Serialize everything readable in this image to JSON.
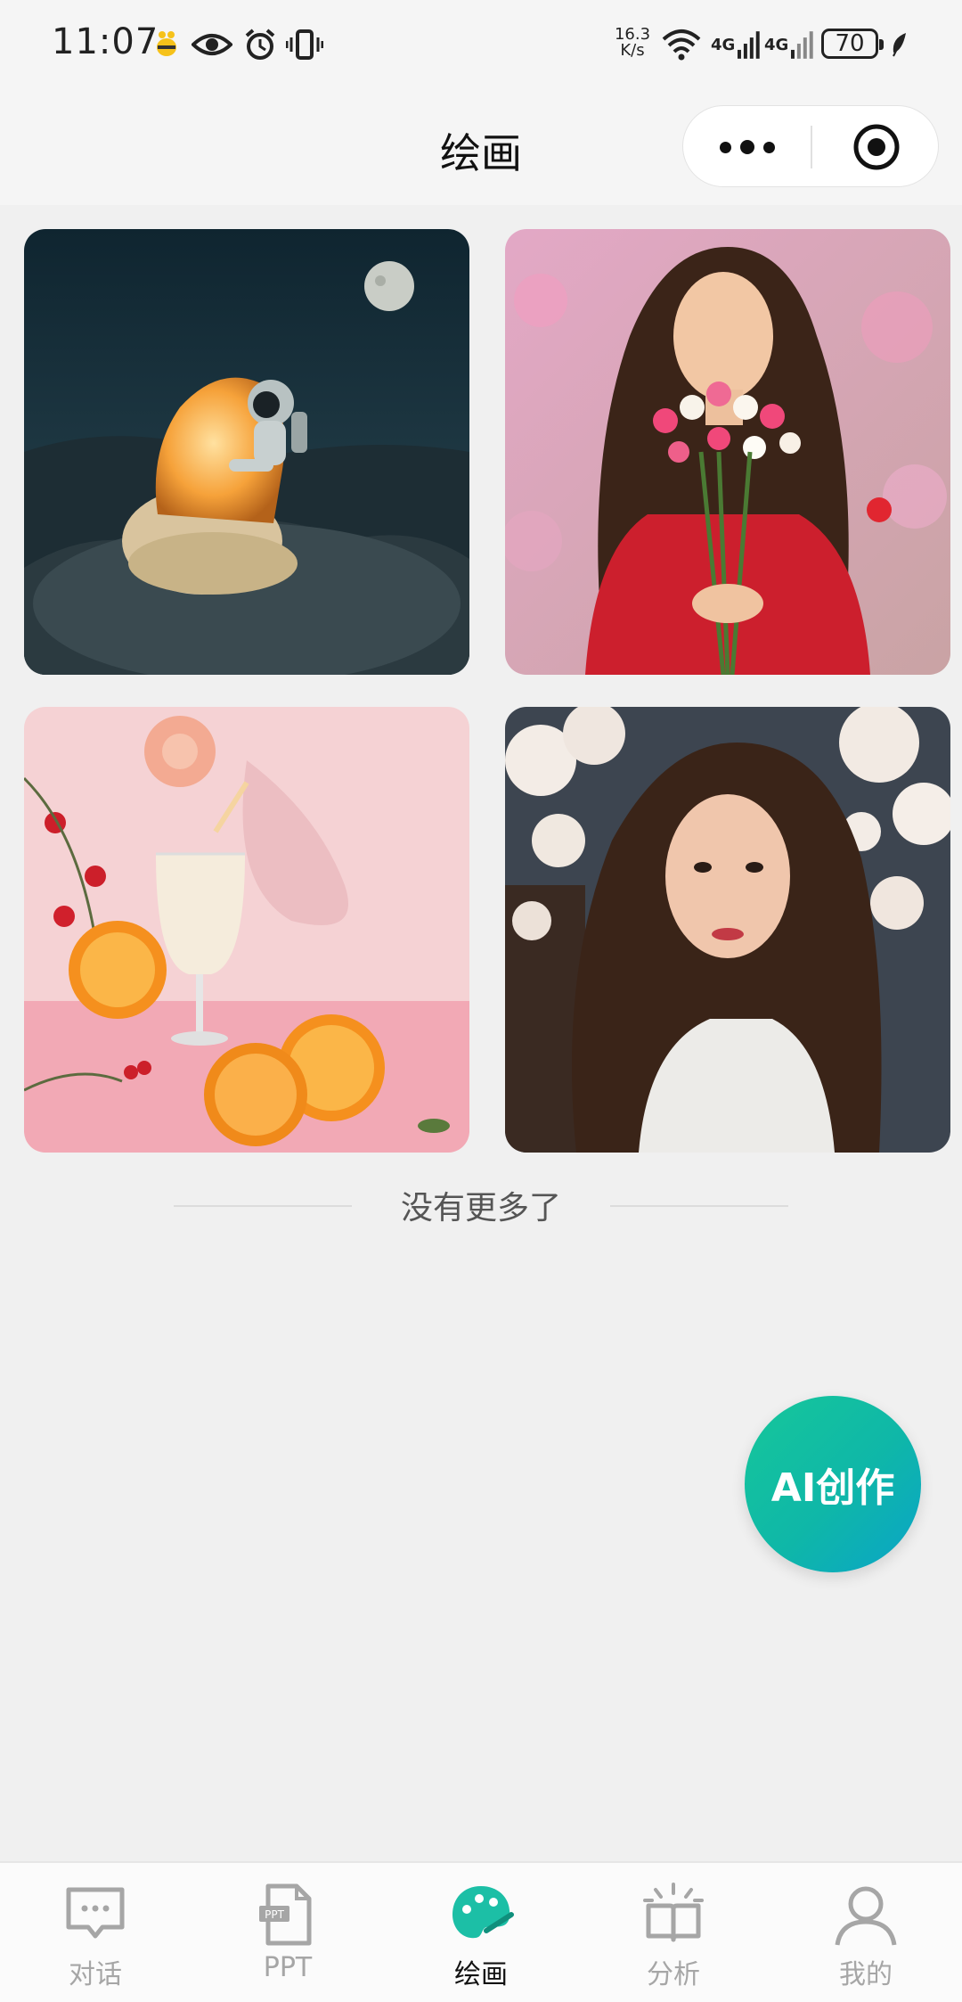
{
  "status_bar": {
    "time": "11:07",
    "net_speed_value": "16.3",
    "net_speed_unit": "K/s",
    "signal1_label": "4G",
    "signal2_label": "4G",
    "battery": "70",
    "icons": [
      "bee-icon",
      "eye-icon",
      "alarm-icon",
      "vibrate-icon",
      "wifi-icon",
      "signal-icon",
      "signal-icon",
      "battery-icon",
      "leaf-icon"
    ]
  },
  "header": {
    "title": "绘画",
    "more_icon": "more-dots-icon",
    "close_icon": "target-close-icon"
  },
  "gallery": {
    "items": [
      {
        "subject": "astronaut-in-glowing-egg",
        "icon": "image"
      },
      {
        "subject": "girl-with-flowers",
        "icon": "image"
      },
      {
        "subject": "milk-glass-with-oranges",
        "icon": "image"
      },
      {
        "subject": "woman-with-blossoms",
        "icon": "image"
      }
    ],
    "end_text": "没有更多了"
  },
  "fab": {
    "label": "AI创作"
  },
  "tabbar": {
    "items": [
      {
        "label": "对话",
        "icon": "chat-icon",
        "active": false
      },
      {
        "label": "PPT",
        "icon": "ppt-file-icon",
        "active": false
      },
      {
        "label": "绘画",
        "icon": "palette-icon",
        "active": true
      },
      {
        "label": "分析",
        "icon": "book-analysis-icon",
        "active": false
      },
      {
        "label": "我的",
        "icon": "profile-icon",
        "active": false
      }
    ]
  },
  "colors": {
    "accent": "#1cbfa6",
    "fab_gradient_start": "#16c79a",
    "fab_gradient_end": "#0aa4c8",
    "inactive_tab": "#a6a6a6"
  }
}
